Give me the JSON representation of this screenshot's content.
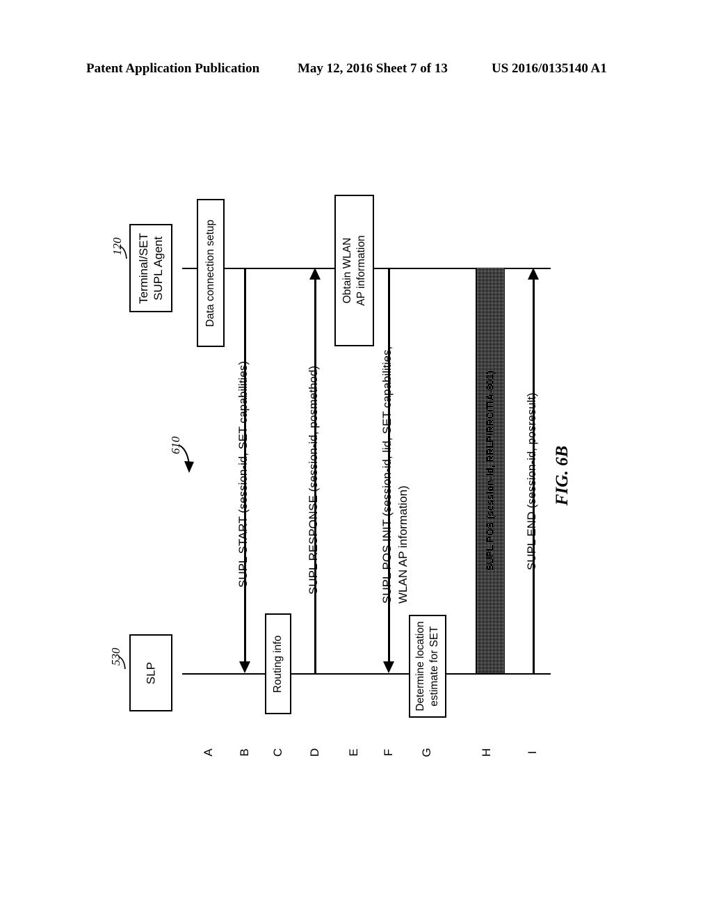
{
  "header": {
    "left": "Patent Application Publication",
    "middle": "May 12, 2016  Sheet 7 of 13",
    "right": "US 2016/0135140 A1"
  },
  "figure": {
    "caption": "FIG. 6B",
    "diagram_ref": "610"
  },
  "lifelines": [
    {
      "id": "terminal",
      "label": "Terminal/SET\nSUPL Agent",
      "label_line1": "Terminal/SET",
      "label_line2": "SUPL Agent",
      "ref": "120"
    },
    {
      "id": "slp",
      "label": "SLP",
      "ref": "530"
    }
  ],
  "action_boxes": [
    {
      "id": "data-connection-setup",
      "label": "Data connection setup",
      "lifeline": "terminal",
      "step": "A"
    },
    {
      "id": "routing-info",
      "label": "Routing info",
      "lifeline": "slp",
      "step": "C"
    },
    {
      "id": "obtain-wlan-ap-information",
      "label_line1": "Obtain WLAN",
      "label_line2": "AP information",
      "lifeline": "terminal",
      "step": "E"
    },
    {
      "id": "determine-location-estimate",
      "label_line1": "Determine location",
      "label_line2": "estimate for SET",
      "lifeline": "slp",
      "step": "G"
    }
  ],
  "messages": [
    {
      "id": "supl-start",
      "step": "B",
      "label_line1": "SUPL START (session-id, SET capabilities)",
      "label_line2": "",
      "direction": "terminal-to-slp"
    },
    {
      "id": "supl-response",
      "step": "D",
      "label_line1": "SUPL RESPONSE (session-id, posmethod)",
      "label_line2": "",
      "direction": "slp-to-terminal"
    },
    {
      "id": "supl-pos-init",
      "step": "F",
      "label_line1": "SUPL POS INIT (session-id, lid, SET capabilities,",
      "label_line2": "WLAN AP information)",
      "direction": "terminal-to-slp"
    },
    {
      "id": "supl-pos",
      "step": "H",
      "label_line1": "SUPL POS (session-id, RRLP/RRC/TIA-801)",
      "label_line2": "",
      "direction": "bidirectional-hatched"
    },
    {
      "id": "supl-end",
      "step": "I",
      "label_line1": "SUPL END (session-id, posresult)",
      "label_line2": "",
      "direction": "slp-to-terminal"
    }
  ],
  "steps": [
    "A",
    "B",
    "C",
    "D",
    "E",
    "F",
    "G",
    "H",
    "I"
  ]
}
